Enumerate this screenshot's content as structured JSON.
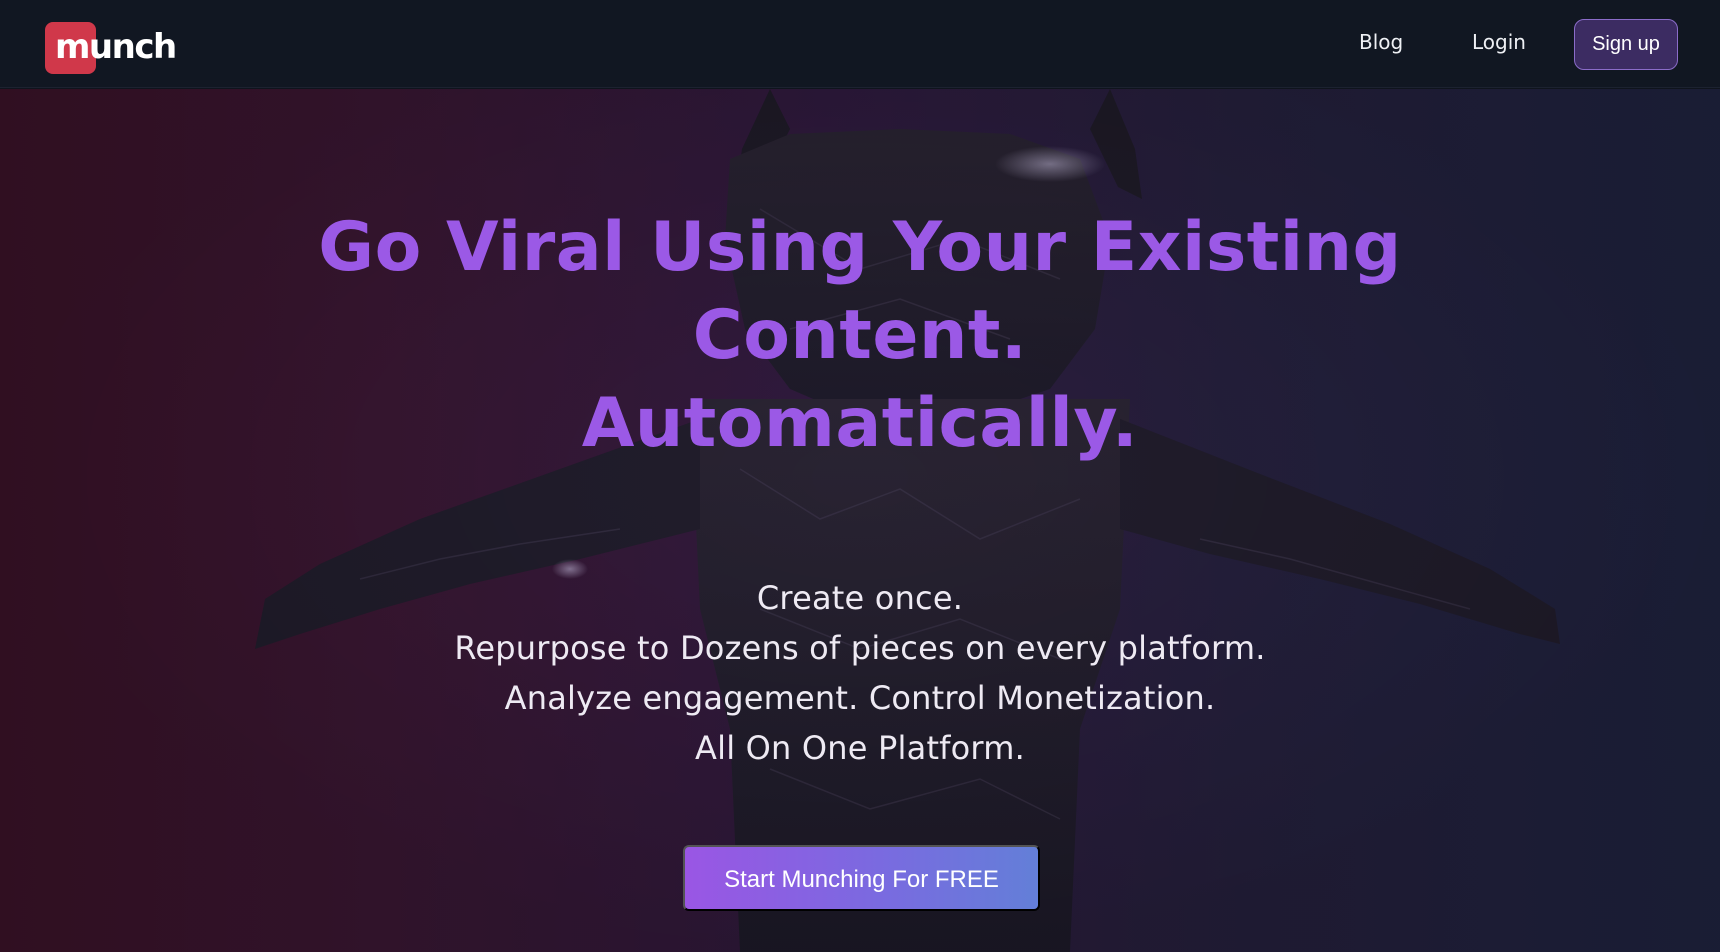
{
  "brand": {
    "logo_text": "munch"
  },
  "nav": {
    "blog_label": "Blog",
    "login_label": "Login",
    "signup_label": "Sign up"
  },
  "hero": {
    "headline_lines": [
      "Go Viral Using Your Existing",
      "Content.",
      "Automatically."
    ],
    "subcopy_lines": [
      "Create once.",
      "Repurpose to Dozens of pieces on every platform.",
      "Analyze engagement. Control Monetization.",
      "All On One Platform."
    ],
    "cta_label": "Start Munching For FREE",
    "background_image": "armored-figure-arms-outstretched"
  },
  "colors": {
    "accent": "#9b59e6",
    "logo_red": "#d0384a",
    "signup_bg": "#3c2c62",
    "navbar_bg": "#111722"
  }
}
